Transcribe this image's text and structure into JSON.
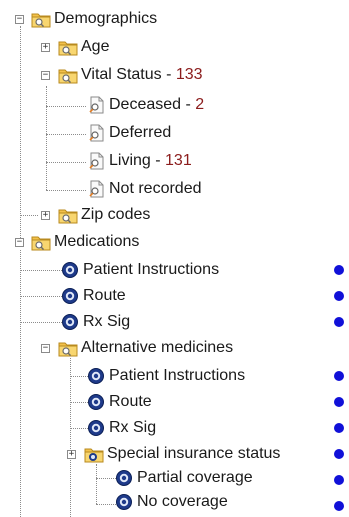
{
  "tree": {
    "demographics": {
      "label": "Demographics",
      "expanded": true,
      "icon": "folder-search-icon"
    },
    "age": {
      "label": "Age",
      "expanded": false,
      "icon": "folder-search-icon"
    },
    "vital_status": {
      "label": "Vital Status - ",
      "count": "133",
      "expanded": true,
      "icon": "folder-search-icon"
    },
    "deceased": {
      "label": "Deceased - ",
      "count": "2",
      "icon": "document-search-icon"
    },
    "deferred": {
      "label": "Deferred",
      "icon": "document-search-icon"
    },
    "living": {
      "label": "Living - ",
      "count": "131",
      "icon": "document-search-icon"
    },
    "not_recorded": {
      "label": "Not recorded",
      "icon": "document-search-icon"
    },
    "zip_codes": {
      "label": "Zip codes",
      "expanded": false,
      "icon": "folder-search-icon"
    },
    "medications": {
      "label": "Medications",
      "expanded": true,
      "icon": "folder-search-icon"
    },
    "med_patient_instructions": {
      "label": "Patient Instructions",
      "icon": "modifier-icon"
    },
    "med_route": {
      "label": "Route",
      "icon": "modifier-icon"
    },
    "med_rx_sig": {
      "label": "Rx Sig",
      "icon": "modifier-icon"
    },
    "alternative_medicines": {
      "label": "Alternative medicines",
      "expanded": true,
      "icon": "folder-search-icon"
    },
    "alt_patient_instructions": {
      "label": "Patient Instructions",
      "icon": "modifier-icon"
    },
    "alt_route": {
      "label": "Route",
      "icon": "modifier-icon"
    },
    "alt_rx_sig": {
      "label": "Rx Sig",
      "icon": "modifier-icon"
    },
    "special_insurance_status": {
      "label": "Special insurance status",
      "expanded": false,
      "icon": "modifier-folder-icon"
    },
    "partial_coverage": {
      "label": "Partial coverage",
      "icon": "modifier-icon"
    },
    "no_coverage": {
      "label": "No coverage",
      "icon": "modifier-icon"
    }
  },
  "colors": {
    "count": "#8b1c1c",
    "marker": "#1010d8",
    "folder": "#f5c542"
  }
}
